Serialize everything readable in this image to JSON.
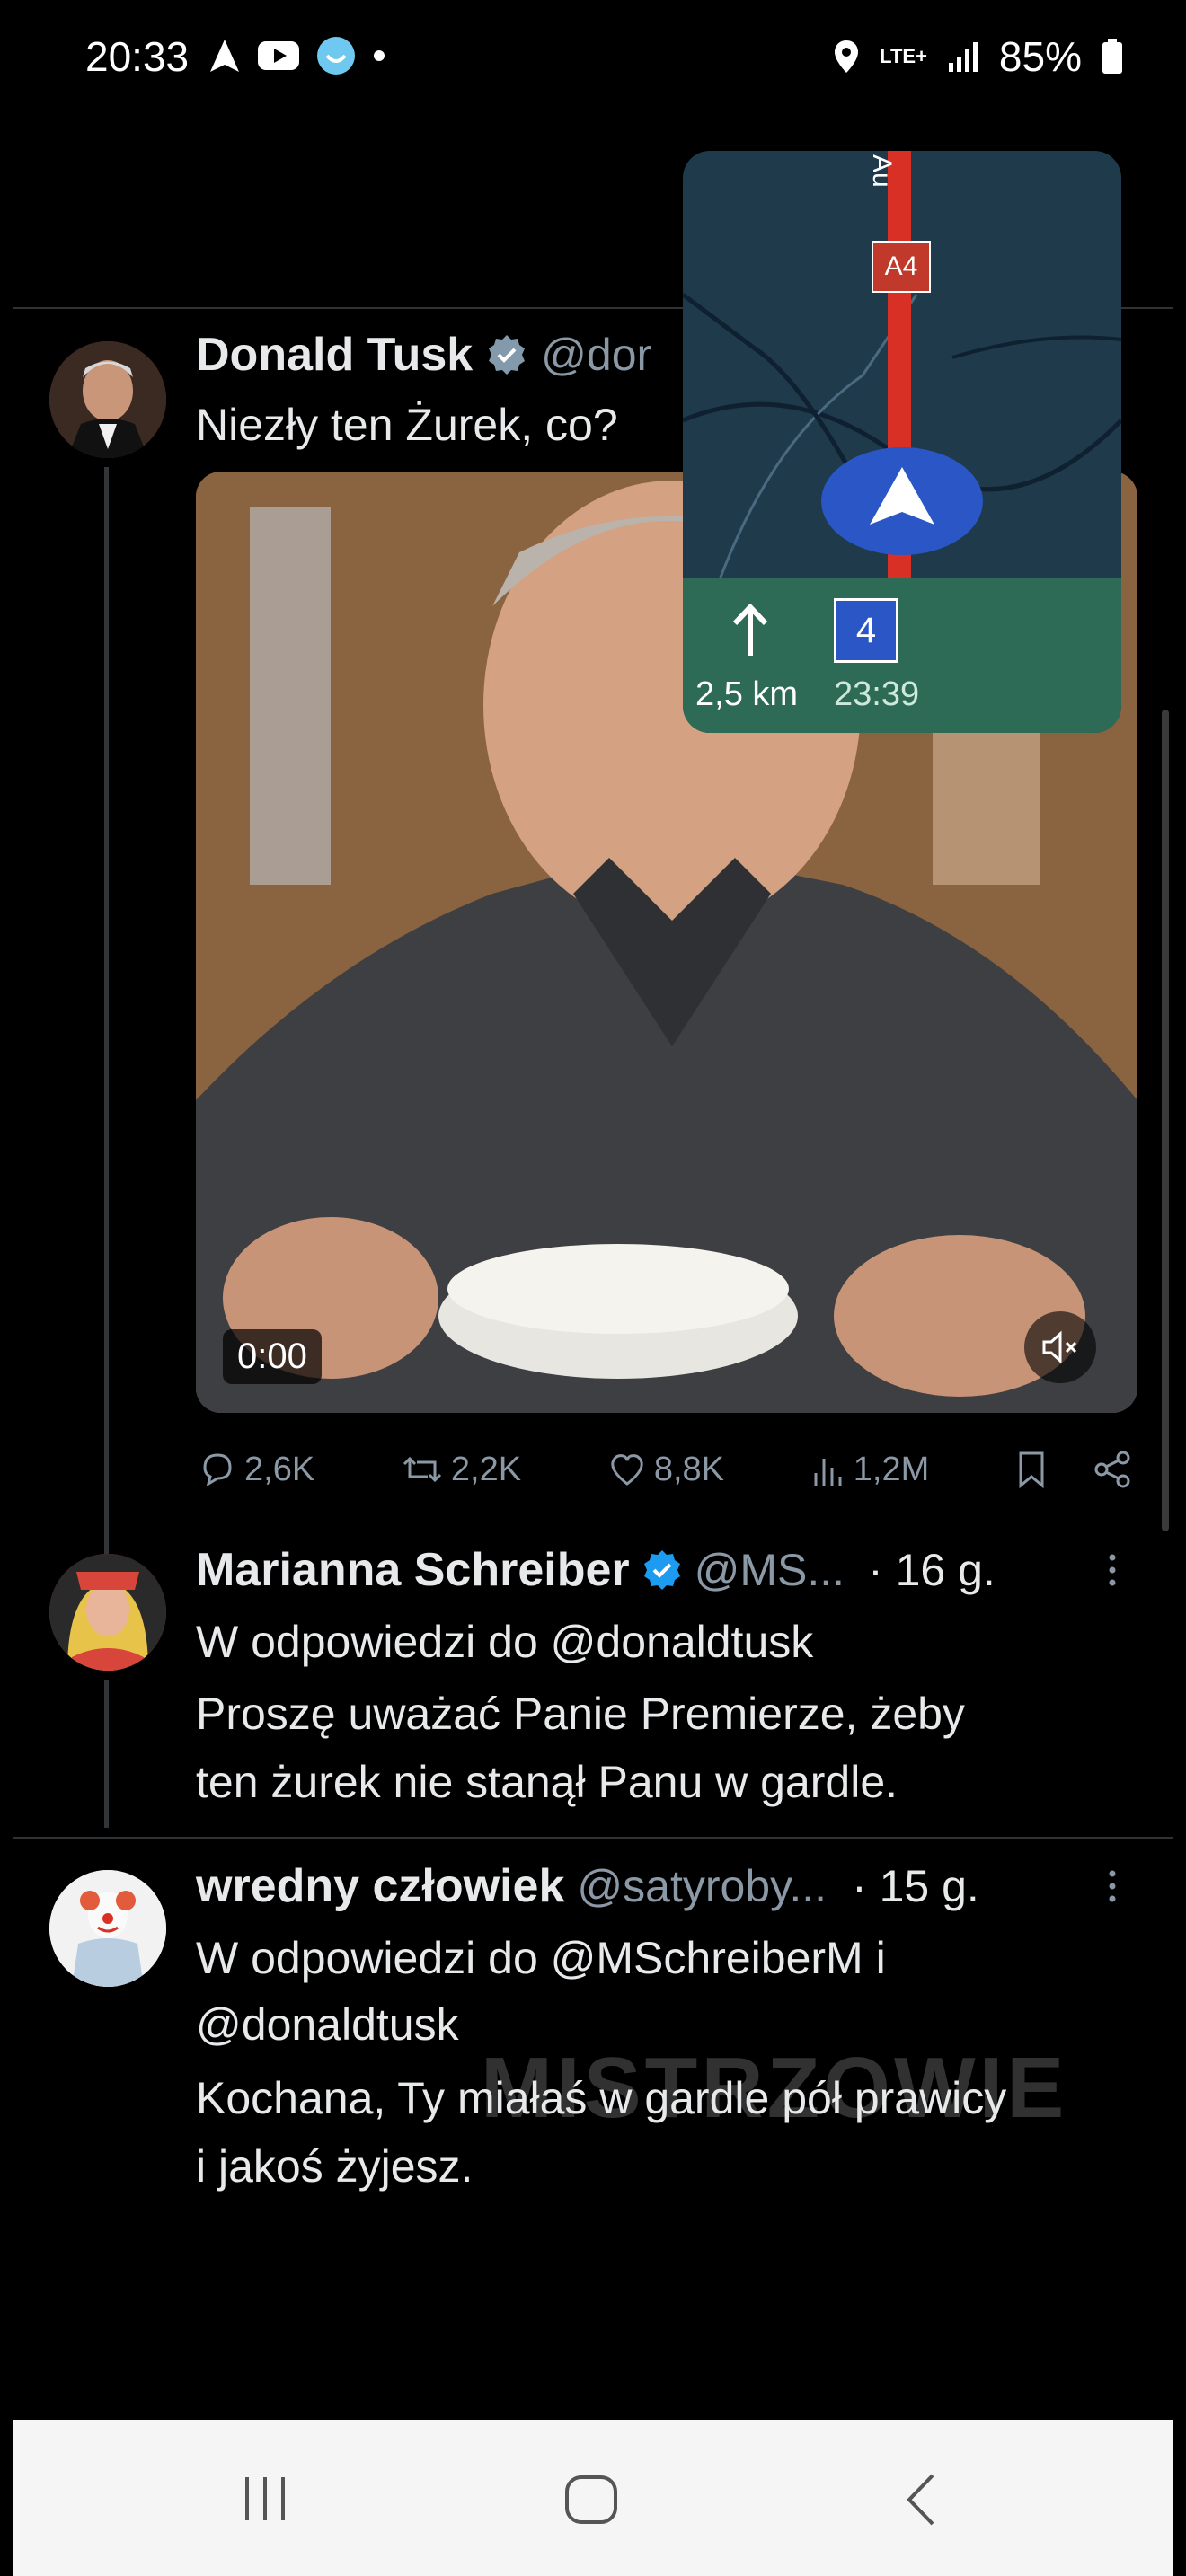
{
  "status_bar": {
    "time": "20:33",
    "network": "LTE+",
    "battery": "85%"
  },
  "navigation_overlay": {
    "road_label": "A4",
    "road_name_partial": "Au",
    "distance": "2,5 km",
    "eta": "23:39",
    "exit_number": "4"
  },
  "tweet": {
    "author_name": "Donald Tusk",
    "author_handle": "@dor",
    "text": "Niezły ten Żurek, co?",
    "video_time": "0:00",
    "replies": "2,6K",
    "reposts": "2,2K",
    "likes": "8,8K",
    "views": "1,2M"
  },
  "replies": [
    {
      "author_name": "Marianna Schreiber",
      "author_handle": "@MS...",
      "time": "· 16 g.",
      "replying_to": "W odpowiedzi do @donaldtusk",
      "text_line1": "Proszę uważać Panie Premierze, żeby",
      "text_line2": "ten żurek nie stanął Panu w gardle."
    },
    {
      "author_name": "wredny człowiek",
      "author_handle": "@satyroby...",
      "time": "· 15 g.",
      "replying_to_line1": "W odpowiedzi do @MSchreiberM i",
      "replying_to_line2": "@donaldtusk",
      "text_line1": "Kochana, Ty miałaś w gardle pół prawicy",
      "text_line2": "i jakoś żyjesz."
    }
  ],
  "watermark": "MISTRZOWIE",
  "colors": {
    "background": "#000000",
    "verified": "#1d9bf0",
    "muted_text": "#8b98a5",
    "nav_panel": "#1f3a4a",
    "nav_bottom": "#2e6b56",
    "route": "#d93025"
  }
}
